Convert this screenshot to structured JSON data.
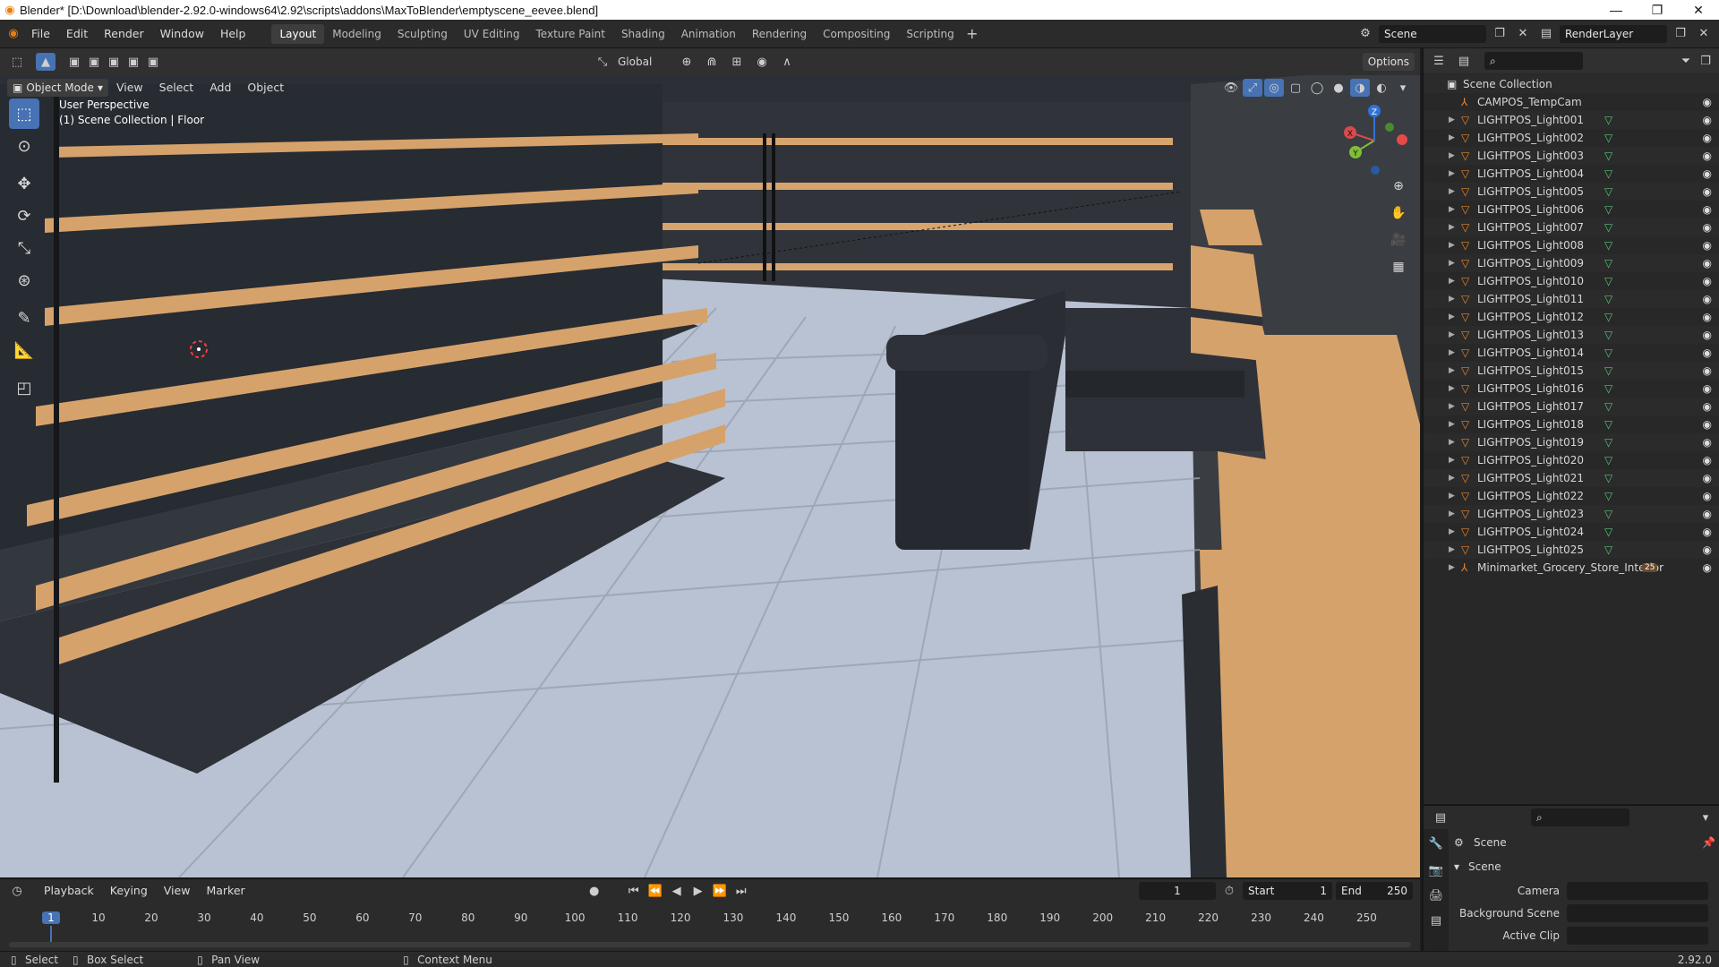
{
  "window": {
    "title": "Blender* [D:\\Download\\blender-2.92.0-windows64\\2.92\\scripts\\addons\\MaxToBlender\\emptyscene_eevee.blend]",
    "controls": [
      "—",
      "❐",
      "✕"
    ]
  },
  "menu": [
    "File",
    "Edit",
    "Render",
    "Window",
    "Help"
  ],
  "workspaces": [
    {
      "label": "Layout",
      "active": true
    },
    {
      "label": "Modeling",
      "active": false
    },
    {
      "label": "Sculpting",
      "active": false
    },
    {
      "label": "UV Editing",
      "active": false
    },
    {
      "label": "Texture Paint",
      "active": false
    },
    {
      "label": "Shading",
      "active": false
    },
    {
      "label": "Animation",
      "active": false
    },
    {
      "label": "Rendering",
      "active": false
    },
    {
      "label": "Compositing",
      "active": false
    },
    {
      "label": "Scripting",
      "active": false
    }
  ],
  "scene_selector": "Scene",
  "view_layer": "RenderLayer",
  "tool_header": {
    "orientation": "Global",
    "options": "Options"
  },
  "viewport_header": {
    "mode": "Object Mode",
    "menus": [
      "View",
      "Select",
      "Add",
      "Object"
    ]
  },
  "viewport_overlay": {
    "perspective": "User Perspective",
    "collection": "(1) Scene Collection | Floor"
  },
  "gizmo": {
    "z": "Z",
    "y": "Y",
    "x": "X"
  },
  "outliner": {
    "root": "Scene Collection",
    "items": [
      "CAMPOS_TempCam",
      "LIGHTPOS_Light001",
      "LIGHTPOS_Light002",
      "LIGHTPOS_Light003",
      "LIGHTPOS_Light004",
      "LIGHTPOS_Light005",
      "LIGHTPOS_Light006",
      "LIGHTPOS_Light007",
      "LIGHTPOS_Light008",
      "LIGHTPOS_Light009",
      "LIGHTPOS_Light010",
      "LIGHTPOS_Light011",
      "LIGHTPOS_Light012",
      "LIGHTPOS_Light013",
      "LIGHTPOS_Light014",
      "LIGHTPOS_Light015",
      "LIGHTPOS_Light016",
      "LIGHTPOS_Light017",
      "LIGHTPOS_Light018",
      "LIGHTPOS_Light019",
      "LIGHTPOS_Light020",
      "LIGHTPOS_Light021",
      "LIGHTPOS_Light022",
      "LIGHTPOS_Light023",
      "LIGHTPOS_Light024",
      "LIGHTPOS_Light025",
      "Minimarket_Grocery_Store_Interior"
    ],
    "last_item_badge": "25"
  },
  "properties": {
    "context": "Scene",
    "panel": "Scene",
    "fields": [
      {
        "label": "Camera",
        "value": ""
      },
      {
        "label": "Background Scene",
        "value": ""
      },
      {
        "label": "Active Clip",
        "value": ""
      }
    ]
  },
  "timeline": {
    "menus": [
      "Playback",
      "Keying",
      "View",
      "Marker"
    ],
    "current_frame": "1",
    "start_label": "Start",
    "start": "1",
    "end_label": "End",
    "end": "250",
    "ticks": [
      "1",
      "10",
      "20",
      "30",
      "40",
      "50",
      "60",
      "70",
      "80",
      "90",
      "100",
      "110",
      "120",
      "130",
      "140",
      "150",
      "160",
      "170",
      "180",
      "190",
      "200",
      "210",
      "220",
      "230",
      "240",
      "250"
    ]
  },
  "statusbar": {
    "items": [
      "Select",
      "Box Select",
      "Pan View",
      "Context Menu"
    ],
    "version": "2.92.0"
  },
  "colors": {
    "accent": "#4772b3",
    "wood": "#d6a26b",
    "shelf_dark": "#262a31",
    "floor": "#b9c2d2",
    "orange_icon": "#e5852b",
    "green_icon": "#57c27a"
  }
}
